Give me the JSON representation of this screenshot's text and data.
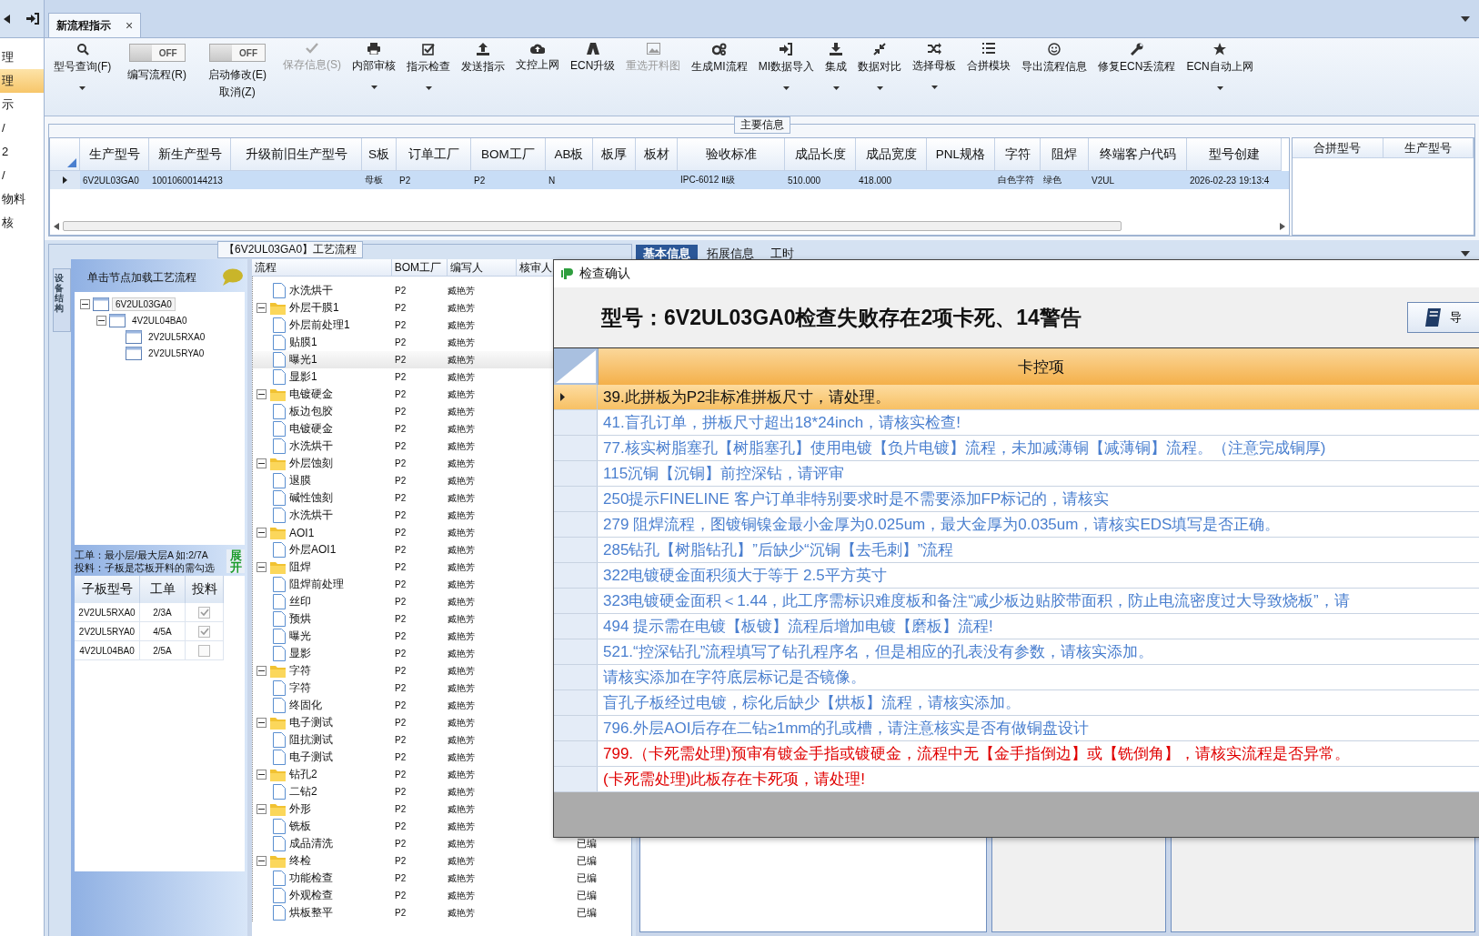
{
  "nav": {
    "items": [
      {
        "label": "理",
        "selected": false
      },
      {
        "label": "理",
        "selected": true
      },
      {
        "label": "示",
        "selected": false
      },
      {
        "label": "/",
        "selected": false
      },
      {
        "label": "2",
        "selected": false
      },
      {
        "label": "/",
        "selected": false
      },
      {
        "label": "物料",
        "selected": false
      },
      {
        "label": "核",
        "selected": false
      }
    ]
  },
  "tabs": [
    {
      "label": "新流程指示",
      "selected": true,
      "close": "×"
    }
  ],
  "toolbar": [
    {
      "kind": "button",
      "label": "型号查询(F)",
      "disabled": false,
      "menu": true
    },
    {
      "kind": "toggle",
      "label": "编写流程(R)",
      "on": false,
      "state_text": "OFF"
    },
    {
      "kind": "toggle",
      "label": "启动修改(E)",
      "sublabel": "取消(Z)",
      "on": false,
      "state_text": "OFF"
    },
    {
      "kind": "button",
      "label": "保存信息(S)",
      "disabled": true,
      "menu": false
    },
    {
      "kind": "button",
      "label": "内部审核",
      "disabled": false,
      "menu": true
    },
    {
      "kind": "button",
      "label": "指示检查",
      "disabled": false,
      "menu": true
    },
    {
      "kind": "button",
      "label": "发送指示",
      "disabled": false,
      "menu": false
    },
    {
      "kind": "button",
      "label": "文控上网",
      "disabled": false,
      "menu": false
    },
    {
      "kind": "button",
      "label": "ECN升级",
      "disabled": false,
      "menu": false
    },
    {
      "kind": "button",
      "label": "重选开料图",
      "disabled": true,
      "menu": false
    },
    {
      "kind": "button",
      "label": "生成MI流程",
      "disabled": false,
      "menu": false
    },
    {
      "kind": "button",
      "label": "MI数据导入",
      "disabled": false,
      "menu": true
    },
    {
      "kind": "button",
      "label": "集成",
      "disabled": false,
      "menu": true
    },
    {
      "kind": "button",
      "label": "数据对比",
      "disabled": false,
      "menu": true
    },
    {
      "kind": "button",
      "label": "选择母板",
      "disabled": false,
      "menu": true
    },
    {
      "kind": "button",
      "label": "合拼模块",
      "disabled": false,
      "menu": false
    },
    {
      "kind": "button",
      "label": "导出流程信息",
      "disabled": false,
      "menu": false
    },
    {
      "kind": "button",
      "label": "修复ECN丢流程",
      "disabled": false,
      "menu": false
    },
    {
      "kind": "button",
      "label": "ECN自动上网",
      "disabled": false,
      "menu": true
    }
  ],
  "main_info": {
    "title": "主要信息",
    "columns": [
      "生产型号",
      "新生产型号",
      "升级前旧生产型号",
      "S板",
      "订单工厂",
      "BOM工厂",
      "AB板",
      "板厚",
      "板材",
      "验收标准",
      "成品长度",
      "成品宽度",
      "PNL规格",
      "字符",
      "阻焊",
      "终端客户代码",
      "型号创建"
    ],
    "rows": [
      {
        "selected": true,
        "cells": [
          "6V2UL03GA0",
          "10010600144213",
          null,
          "母板",
          "P2",
          "P2",
          "N",
          null,
          null,
          "IPC-6012 Ⅱ级",
          "510.000",
          "418.000",
          null,
          "白色字符",
          "绿色",
          "V2UL",
          "2026-02-23 19:13:4"
        ]
      }
    ],
    "side_columns": [
      "合拼型号",
      "生产型号"
    ]
  },
  "process": {
    "title": "【6V2UL03GA0】工艺流程",
    "side_tab": "设备结构",
    "tree_hint": "单击节点加载工艺流程",
    "tree": [
      {
        "label": "6V2UL03GA0",
        "expanded": true,
        "selected": true,
        "children": [
          {
            "label": "4V2UL04BA0",
            "expanded": true,
            "selected": false,
            "children": [
              {
                "label": "2V2UL5RXA0",
                "selected": false
              },
              {
                "label": "2V2UL5RYA0",
                "selected": false
              }
            ]
          }
        ]
      }
    ],
    "notes": [
      "工单：最小层/最大层A 如:2/7A",
      "投料：子板是芯板开料的需勾选"
    ],
    "expand_button": "展开",
    "sub_columns": [
      "子板型号",
      "工单",
      "投料"
    ],
    "sub_rows": [
      {
        "model": "2V2UL5RXA0",
        "order": "2/3A",
        "checked": true
      },
      {
        "model": "2V2UL5RYA0",
        "order": "4/5A",
        "checked": true
      },
      {
        "model": "4V2UL04BA0",
        "order": "2/5A",
        "checked": false
      }
    ],
    "flow_columns": [
      "流程",
      "BOM工厂",
      "编写人",
      "核审人"
    ],
    "flow": [
      {
        "kind": "group",
        "children": [
          {
            "name": "水洗烘干",
            "bom": "P2",
            "author": "臧艳芳",
            "selected": false
          }
        ]
      },
      {
        "kind": "group",
        "name": "外层干膜1",
        "bom": "P2",
        "author": "臧艳芳",
        "expanded": true,
        "selected": false,
        "children": [
          {
            "name": "外层前处理1",
            "bom": "P2",
            "author": "臧艳芳",
            "selected": false
          },
          {
            "name": "贴膜1",
            "bom": "P2",
            "author": "臧艳芳",
            "selected": false
          },
          {
            "name": "曝光1",
            "bom": "P2",
            "author": "臧艳芳",
            "selected": true
          },
          {
            "name": "显影1",
            "bom": "P2",
            "author": "臧艳芳",
            "selected": false
          }
        ]
      },
      {
        "kind": "group",
        "name": "电镀硬金",
        "bom": "P2",
        "author": "臧艳芳",
        "expanded": true,
        "selected": false,
        "children": [
          {
            "name": "板边包胶",
            "bom": "P2",
            "author": "臧艳芳",
            "selected": false
          },
          {
            "name": "电镀硬金",
            "bom": "P2",
            "author": "臧艳芳",
            "selected": false
          },
          {
            "name": "水洗烘干",
            "bom": "P2",
            "author": "臧艳芳",
            "selected": false
          }
        ]
      },
      {
        "kind": "group",
        "name": "外层蚀刻",
        "bom": "P2",
        "author": "臧艳芳",
        "expanded": true,
        "selected": false,
        "children": [
          {
            "name": "退膜",
            "bom": "P2",
            "author": "臧艳芳",
            "selected": false
          },
          {
            "name": "碱性蚀刻",
            "bom": "P2",
            "author": "臧艳芳",
            "selected": false
          },
          {
            "name": "水洗烘干",
            "bom": "P2",
            "author": "臧艳芳",
            "selected": false
          }
        ]
      },
      {
        "kind": "group",
        "name": "AOI1",
        "bom": "P2",
        "author": "臧艳芳",
        "expanded": true,
        "selected": false,
        "children": [
          {
            "name": "外层AOI1",
            "bom": "P2",
            "author": "臧艳芳",
            "selected": false
          }
        ]
      },
      {
        "kind": "group",
        "name": "阻焊",
        "bom": "P2",
        "author": "臧艳芳",
        "expanded": true,
        "selected": false,
        "children": [
          {
            "name": "阻焊前处理",
            "bom": "P2",
            "author": "臧艳芳",
            "selected": false
          },
          {
            "name": "丝印",
            "bom": "P2",
            "author": "臧艳芳",
            "selected": false
          },
          {
            "name": "预烘",
            "bom": "P2",
            "author": "臧艳芳",
            "selected": false
          },
          {
            "name": "曝光",
            "bom": "P2",
            "author": "臧艳芳",
            "selected": false
          },
          {
            "name": "显影",
            "bom": "P2",
            "author": "臧艳芳",
            "selected": false
          }
        ]
      },
      {
        "kind": "group",
        "name": "字符",
        "bom": "P2",
        "author": "臧艳芳",
        "expanded": true,
        "selected": false,
        "children": [
          {
            "name": "字符",
            "bom": "P2",
            "author": "臧艳芳",
            "selected": false
          },
          {
            "name": "终固化",
            "bom": "P2",
            "author": "臧艳芳",
            "selected": false
          }
        ]
      },
      {
        "kind": "group",
        "name": "电子测试",
        "bom": "P2",
        "author": "臧艳芳",
        "expanded": true,
        "selected": false,
        "children": [
          {
            "name": "阻抗测试",
            "bom": "P2",
            "author": "臧艳芳",
            "selected": false
          },
          {
            "name": "电子测试",
            "bom": "P2",
            "author": "臧艳芳",
            "selected": false
          }
        ]
      },
      {
        "kind": "group",
        "name": "钻孔2",
        "bom": "P2",
        "author": "臧艳芳",
        "expanded": true,
        "selected": false,
        "children": [
          {
            "name": "二钻2",
            "bom": "P2",
            "author": "臧艳芳",
            "selected": false
          }
        ]
      },
      {
        "kind": "group",
        "name": "外形",
        "bom": "P2",
        "author": "臧艳芳",
        "expanded": true,
        "selected": false,
        "children": [
          {
            "name": "铣板",
            "bom": "P2",
            "author": "臧艳芳",
            "selected": false
          },
          {
            "name": "成品清洗",
            "bom": "P2",
            "author": "臧艳芳",
            "status": "已编",
            "selected": false
          }
        ]
      },
      {
        "kind": "group",
        "name": "终检",
        "bom": "P2",
        "author": "臧艳芳",
        "status": "已编",
        "expanded": true,
        "selected": false,
        "children": [
          {
            "name": "功能检查",
            "bom": "P2",
            "author": "臧艳芳",
            "status": "已编",
            "selected": false
          },
          {
            "name": "外观检查",
            "bom": "P2",
            "author": "臧艳芳",
            "status": "已编",
            "selected": false
          },
          {
            "name": "烘板整平",
            "bom": "P2",
            "author": "臧艳芳",
            "status": "已编",
            "selected": false
          }
        ]
      }
    ]
  },
  "detail_tabs": [
    {
      "label": "基本信息",
      "selected": true
    },
    {
      "label": "拓展信息",
      "selected": false
    },
    {
      "label": "工时",
      "selected": false
    }
  ],
  "dialog": {
    "title": "检查确认",
    "heading": "型号：6V2UL03GA0检查失败存在2项卡死、14警告",
    "export_button": "导",
    "column": "卡控项",
    "rows": [
      {
        "kind": "warning",
        "selected": true,
        "text": "39.此拼板为P2非标准拼板尺寸，请处理。"
      },
      {
        "kind": "warning",
        "selected": false,
        "text": "41.盲孔订单，拼板尺寸超出18*24inch，请核实检查!"
      },
      {
        "kind": "warning",
        "selected": false,
        "text": "77.核实树脂塞孔【树脂塞孔】使用电镀【负片电镀】流程，未加减薄铜【减薄铜】流程。（注意完成铜厚)"
      },
      {
        "kind": "warning",
        "selected": false,
        "text": "115沉铜【沉铜】前控深钻，请评审"
      },
      {
        "kind": "warning",
        "selected": false,
        "text": "250提示FINELINE 客户订单非特别要求时是不需要添加FP标记的，请核实"
      },
      {
        "kind": "warning",
        "selected": false,
        "text": "279 阻焊流程，图镀铜镍金最小金厚为0.025um，最大金厚为0.035um，请核实EDS填写是否正确。"
      },
      {
        "kind": "warning",
        "selected": false,
        "text": "285钻孔【树脂钻孔】”后缺少“沉铜【去毛刺】”流程"
      },
      {
        "kind": "warning",
        "selected": false,
        "text": "322电镀硬金面积须大于等于 2.5平方英寸"
      },
      {
        "kind": "warning",
        "selected": false,
        "text": "323电镀硬金面积＜1.44，此工序需标识难度板和备注“减少板边贴胶带面积，防止电流密度过大导致烧板”，请"
      },
      {
        "kind": "warning",
        "selected": false,
        "text": "494 提示需在电镀【板镀】流程后增加电镀【磨板】流程!"
      },
      {
        "kind": "warning",
        "selected": false,
        "text": "521.“控深钻孔”流程填写了钻孔程序名，但是相应的孔表没有参数，请核实添加。"
      },
      {
        "kind": "warning",
        "selected": false,
        "text": "请核实添加在字符底层标记是否镜像。"
      },
      {
        "kind": "warning",
        "selected": false,
        "text": "盲孔子板经过电镀，棕化后缺少【烘板】流程，请核实添加。"
      },
      {
        "kind": "warning",
        "selected": false,
        "text": "796.外层AOI后存在二钻≥1mm的孔或槽，请注意核实是否有做铜盘设计"
      },
      {
        "kind": "fatal",
        "selected": false,
        "text": "799.（卡死需处理)预审有镀金手指或镀硬金，流程中无【金手指倒边】或【铣倒角】，请核实流程是否异常。"
      },
      {
        "kind": "fatal",
        "selected": false,
        "text": "(卡死需处理)此板存在卡死项，请处理!"
      }
    ]
  }
}
